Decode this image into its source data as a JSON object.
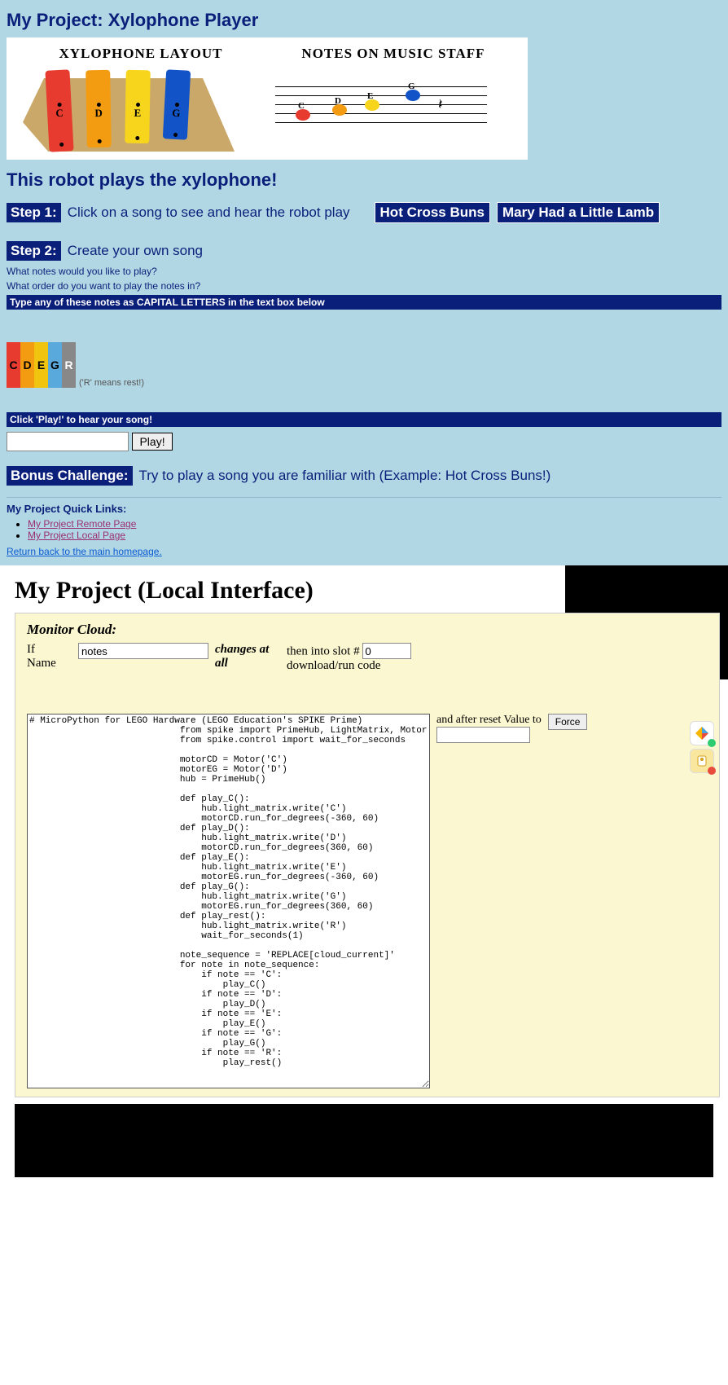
{
  "header": {
    "title": "My Project: Xylophone Player",
    "illus_left_title": "XYLOPHONE LAYOUT",
    "illus_right_title": "NOTES ON MUSIC STAFF",
    "bar_c": "C",
    "bar_d": "D",
    "bar_e": "E",
    "bar_g": "G",
    "subtitle": "This robot plays the xylophone!"
  },
  "step1": {
    "badge": "Step 1:",
    "text": "Click on a song to see and hear the robot play",
    "song1": "Hot Cross Buns",
    "song2": "Mary Had a Little Lamb"
  },
  "step2": {
    "badge": "Step 2:",
    "text": "Create your own song",
    "q1": "What notes would you like to play?",
    "q2": "What order do you want to play the notes in?",
    "band1": "Type any of these notes as CAPITAL LETTERS in the text box below",
    "keys": {
      "c": "C",
      "d": "D",
      "e": "E",
      "g": "G",
      "r": "R"
    },
    "rest_hint": "('R' means rest!)",
    "band2": "Click 'Play!' to hear your song!",
    "play_btn": "Play!"
  },
  "bonus": {
    "badge": "Bonus Challenge:",
    "text": "Try to play a song you are familiar with (Example: Hot Cross Buns!)"
  },
  "quicklinks": {
    "title": "My Project Quick Links:",
    "l1": "My Project Remote Page",
    "l2": "My Project Local Page",
    "home": "Return back to the main homepage."
  },
  "local": {
    "title": "My Project (Local Interface)",
    "monitor_title": "Monitor Cloud:",
    "if_name": "If Name",
    "name_value": "notes",
    "changes": "changes at all",
    "slot_label": "then into slot #",
    "slot_value": "0",
    "run_label": "download/run code",
    "reset_label": "and after reset Value to",
    "force": "Force",
    "code": "# MicroPython for LEGO Hardware (LEGO Education's SPIKE Prime)\n                            from spike import PrimeHub, LightMatrix, Motor\n                            from spike.control import wait_for_seconds\n\n                            motorCD = Motor('C')\n                            motorEG = Motor('D')\n                            hub = PrimeHub()\n\n                            def play_C():\n                                hub.light_matrix.write('C')\n                                motorCD.run_for_degrees(-360, 60)\n                            def play_D():\n                                hub.light_matrix.write('D')\n                                motorCD.run_for_degrees(360, 60)\n                            def play_E():\n                                hub.light_matrix.write('E')\n                                motorEG.run_for_degrees(-360, 60)\n                            def play_G():\n                                hub.light_matrix.write('G')\n                                motorEG.run_for_degrees(360, 60)\n                            def play_rest():\n                                hub.light_matrix.write('R')\n                                wait_for_seconds(1)\n\n                            note_sequence = 'REPLACE[cloud_current]'\n                            for note in note_sequence:\n                                if note == 'C':\n                                    play_C()\n                                if note == 'D':\n                                    play_D()\n                                if note == 'E':\n                                    play_E()\n                                if note == 'G':\n                                    play_G()\n                                if note == 'R':\n                                    play_rest()"
  }
}
